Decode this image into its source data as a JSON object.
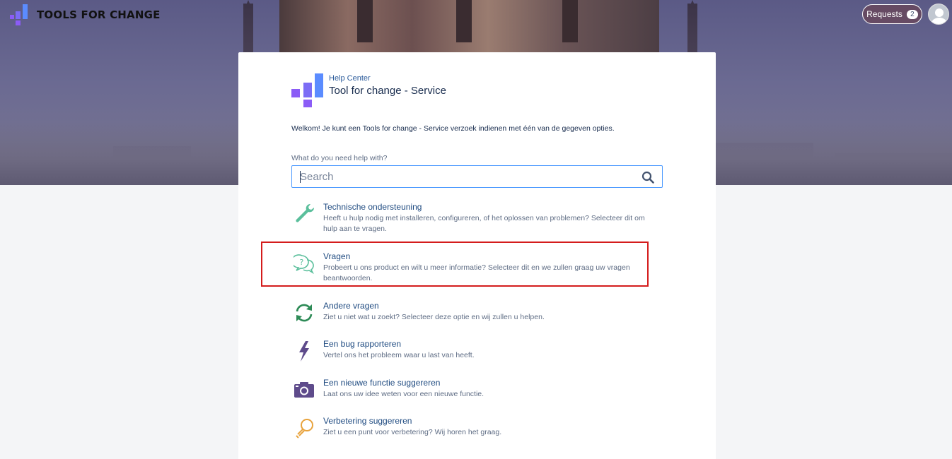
{
  "nav": {
    "brand": "TOOLS FOR CHANGE",
    "requests_label": "Requests",
    "requests_count": "2"
  },
  "help_center": {
    "subtitle": "Help Center",
    "title": "Tool for change - Service",
    "welcome": "Welkom! Je kunt een Tools for change - Service verzoek indienen met één van de gegeven opties."
  },
  "search": {
    "label": "What do you need help with?",
    "placeholder": "Search",
    "value": ""
  },
  "request_types": [
    {
      "name": "Technische ondersteuning",
      "description": "Heeft u hulp nodig met installeren, configureren, of het oplossen van problemen? Selecteer dit om hulp aan te vragen.",
      "icon": "wrench-icon",
      "color": "#5bbf9c"
    },
    {
      "name": "Vragen",
      "description": "Probeert u ons product en wilt u meer informatie? Selecteer dit en we zullen graag uw vragen beantwoorden.",
      "icon": "question-bubbles-icon",
      "color": "#5bbf9c"
    },
    {
      "name": "Andere vragen",
      "description": "Ziet u niet wat u zoekt? Selecteer deze optie en wij zullen u helpen.",
      "icon": "refresh-arrows-icon",
      "color": "#2e8b57"
    },
    {
      "name": "Een bug rapporteren",
      "description": "Vertel ons het probleem waar u last van heeft.",
      "icon": "lightning-bolt-icon",
      "color": "#5e4b8b"
    },
    {
      "name": "Een nieuwe functie suggereren",
      "description": "Laat ons uw idee weten voor een nieuwe functie.",
      "icon": "camera-icon",
      "color": "#5e4b8b"
    },
    {
      "name": "Verbetering suggereren",
      "description": "Ziet u een punt voor verbetering? Wij horen het graag.",
      "icon": "lightbulb-icon",
      "color": "#e8a33d"
    }
  ],
  "colors": {
    "brand_purple": "#8b5cf6",
    "brand_blue": "#4c8dff",
    "link": "#1e4a80",
    "highlight": "#d41c1c"
  }
}
